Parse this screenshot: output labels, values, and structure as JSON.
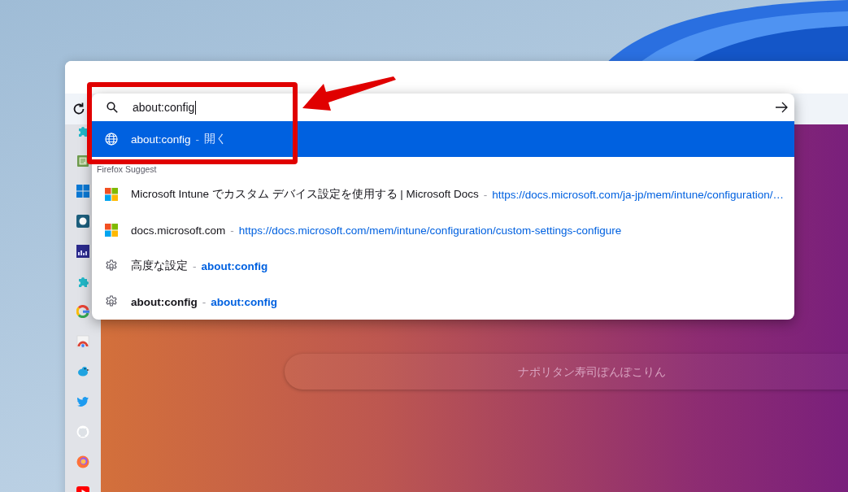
{
  "search": {
    "value": "about:config"
  },
  "heuristic": {
    "kind": "globe",
    "title": "about:config",
    "separator": "-",
    "action": "開く",
    "selected": true
  },
  "group_label": "Firefox Suggest",
  "results": [
    {
      "kind": "microsoft",
      "title": "Microsoft Intune でカスタム デバイス設定を使用する | Microsoft Docs",
      "separator": "-",
      "url": "https://docs.microsoft.com/ja-jp/mem/intune/configuration/…",
      "emphasized": false,
      "selected": false
    },
    {
      "kind": "microsoft",
      "title": "docs.microsoft.com",
      "separator": "-",
      "url": "https://docs.microsoft.com/mem/intune/configuration/custom-settings-configure",
      "emphasized": false,
      "selected": false
    },
    {
      "kind": "gear",
      "title": "高度な設定",
      "separator": "-",
      "url": "about:config",
      "emphasized": false,
      "selected": false
    },
    {
      "kind": "gear",
      "title": "about:config",
      "separator": "-",
      "url": "about:config",
      "emphasized": true,
      "selected": false
    }
  ],
  "new_tab_search": {
    "placeholder": "ナポリタン寿司ぽんぽこりん"
  }
}
